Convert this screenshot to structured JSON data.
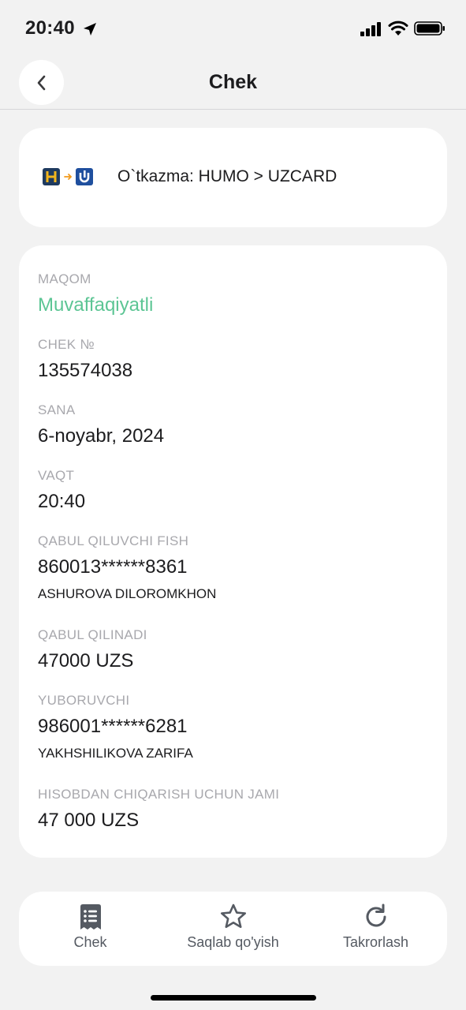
{
  "status_bar": {
    "time": "20:40"
  },
  "header": {
    "title": "Chek",
    "back_icon": "chevron-left-icon"
  },
  "transfer": {
    "title": "O`tkazma: HUMO > UZCARD",
    "from_logo": "humo-logo",
    "to_logo": "uzcard-logo"
  },
  "details": {
    "status": {
      "label": "MAQOM",
      "value": "Muvaffaqiyatli",
      "color": "#5cc594"
    },
    "receipt_number": {
      "label": "CHEK №",
      "value": "135574038"
    },
    "date": {
      "label": "SANA",
      "value": "6-noyabr, 2024"
    },
    "time": {
      "label": "VAQT",
      "value": "20:40"
    },
    "recipient": {
      "label": "QABUL QILUVCHI FISH",
      "card": "860013******8361",
      "name": "ASHUROVA DILOROMKHON"
    },
    "received": {
      "label": "QABUL QILINADI",
      "value": "47000 UZS"
    },
    "sender": {
      "label": "YUBORUVCHI",
      "card": "986001******6281",
      "name": "YAKHSHILIKOVA ZARIFA"
    },
    "total": {
      "label": "HISOBDAN CHIQARISH UCHUN JAMI",
      "value": "47 000 UZS"
    }
  },
  "actions": [
    {
      "label": "Chek",
      "icon": "receipt-icon"
    },
    {
      "label": "Saqlab qo'yish",
      "icon": "star-icon"
    },
    {
      "label": "Takrorlash",
      "icon": "refresh-icon"
    }
  ]
}
